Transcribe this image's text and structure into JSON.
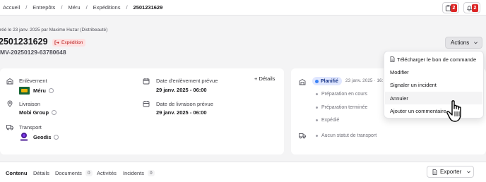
{
  "breadcrumb": {
    "items": [
      "Accueil",
      "Entrepôts",
      "Méru",
      "Expéditions"
    ],
    "current": "2501231629"
  },
  "top_icons": {
    "clipboard_count": "2",
    "bell_count": "2"
  },
  "header": {
    "meta": "réé le 23 janv. 2025 par Maxime Huzar (Distribeauté)",
    "title": "2501231629",
    "type_badge": "Expédition",
    "subtitle": "MV-20250129-63780648",
    "actions_label": "Actions"
  },
  "details": {
    "pickup": {
      "label": "Enlèvement",
      "value": "Méru"
    },
    "delivery": {
      "label": "Livraison",
      "value": "Mobi Group"
    },
    "transport": {
      "label": "Transport",
      "value": "Geodis"
    },
    "pickup_date": {
      "label": "Date d'enlèvement prévue",
      "value": "29 janv. 2025 - 06:00"
    },
    "delivery_date": {
      "label": "Date de livraison prévue",
      "value": "29 janv. 2025 - 06:00"
    },
    "details_link": "Détails"
  },
  "status": {
    "current": "Planifié",
    "current_date": "23 janv. 2025 · 16:",
    "steps": [
      "Préparation en cours",
      "Préparation terminée",
      "Expédié"
    ],
    "transport_status": "Aucun statut de transport"
  },
  "actions_menu": {
    "items": [
      "Télécharger le bon de commande",
      "Modifier",
      "Signaler un incident",
      "Annuler",
      "Ajouter un commentaire"
    ],
    "hovered_index": 3
  },
  "tabs": [
    {
      "label": "Contenu",
      "count": null
    },
    {
      "label": "Détails",
      "count": null
    },
    {
      "label": "Documents",
      "count": "0"
    },
    {
      "label": "Activités",
      "count": null
    },
    {
      "label": "Incidents",
      "count": "0"
    }
  ],
  "export_label": "Exporter",
  "colors": {
    "badge_red": "#dc2626",
    "status_blue": "#3b82f6",
    "expedition_badge_bg": "#fee2e2"
  }
}
